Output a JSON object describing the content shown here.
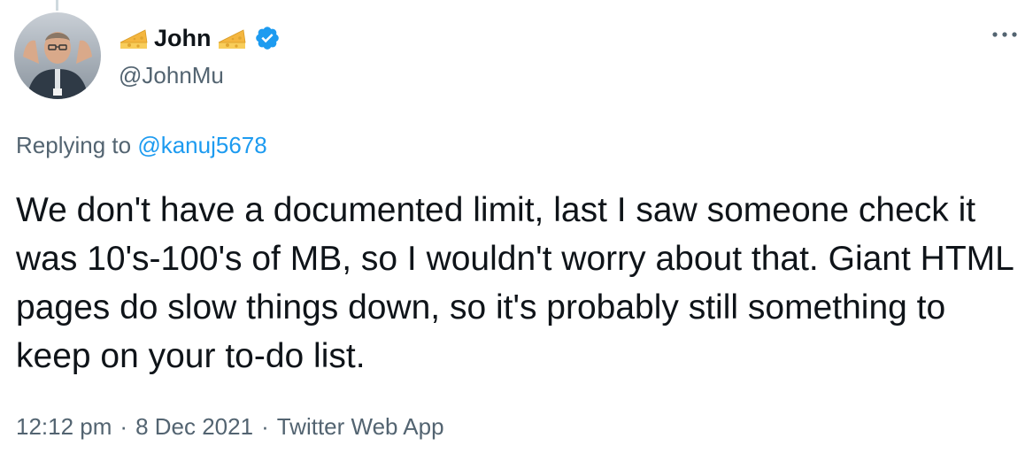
{
  "author": {
    "display_name": "John",
    "handle": "@JohnMu",
    "verified": true,
    "name_emoji": "cheese-wedge-icon"
  },
  "reply": {
    "prefix": "Replying to",
    "mention": "@kanuj5678"
  },
  "tweet": {
    "text": "We don't have a documented limit, last I saw someone check it was 10's-100's of MB, so I wouldn't worry about that. Giant HTML pages do slow things down, so it's probably still something to keep on your to-do list."
  },
  "meta": {
    "time": "12:12 pm",
    "date": "8 Dec 2021",
    "source": "Twitter Web App",
    "separator": "·"
  },
  "colors": {
    "text": "#0f1419",
    "secondary": "#536471",
    "accent": "#1d9bf0",
    "verified": "#1d9bf0"
  },
  "icons": {
    "more": "more-horizontal-icon",
    "verified": "verified-badge-icon",
    "cheese": "cheese-wedge-icon"
  }
}
